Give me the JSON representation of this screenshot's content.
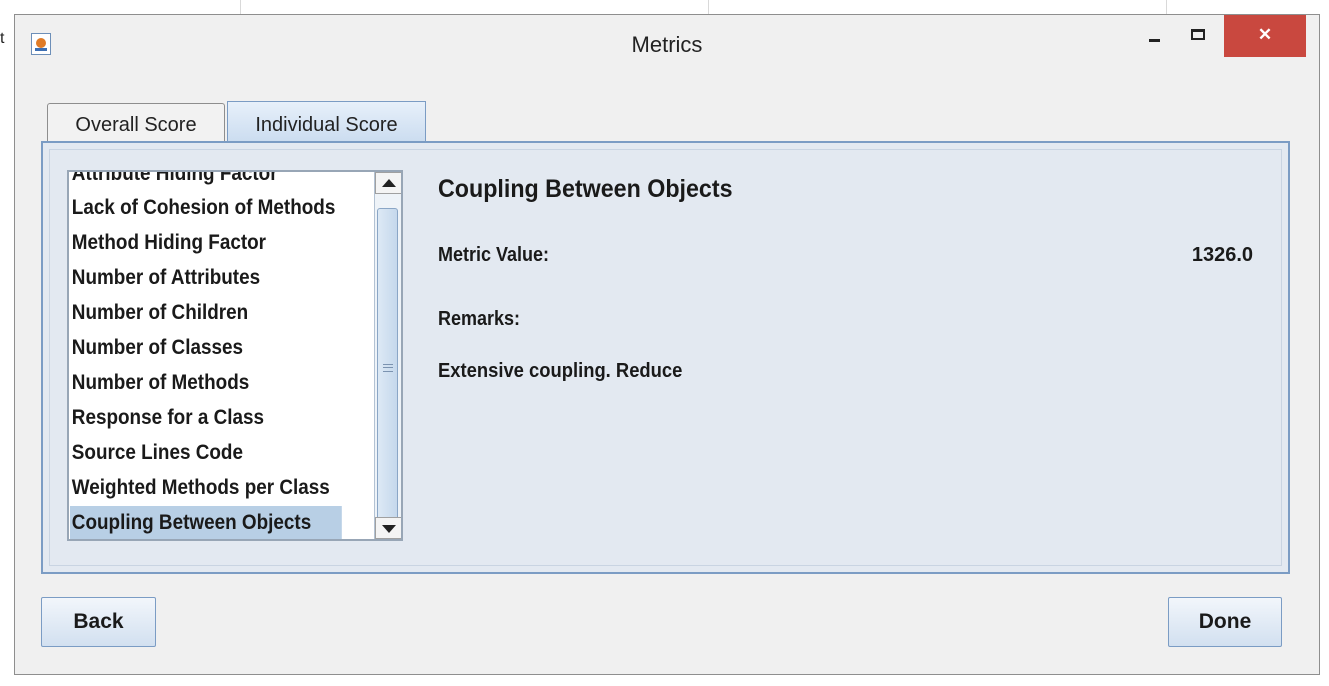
{
  "window": {
    "title": "Metrics",
    "close_glyph": "✕"
  },
  "tabs": [
    {
      "label": "Overall Score",
      "active": false
    },
    {
      "label": "Individual Score",
      "active": true
    }
  ],
  "metrics_list": {
    "items": [
      "Attribute Hiding Factor",
      "Lack of Cohesion of Methods",
      "Method Hiding Factor",
      "Number of Attributes",
      "Number of Children",
      "Number of Classes",
      "Number of Methods",
      "Response for a Class",
      "Source Lines Code",
      "Weighted Methods per Class",
      "Coupling Between Objects"
    ],
    "selected": "Coupling Between Objects"
  },
  "detail": {
    "title": "Coupling Between Objects",
    "metric_value_label": "Metric Value:",
    "metric_value": "1326.0",
    "remarks_label": "Remarks:",
    "remarks_text": "Extensive coupling. Reduce"
  },
  "buttons": {
    "back": "Back",
    "done": "Done"
  },
  "background": {
    "stray_text": "t"
  },
  "colors": {
    "selection": "#b8cfe5",
    "close_button": "#c9483f",
    "accent_border": "#7b9cc4"
  }
}
